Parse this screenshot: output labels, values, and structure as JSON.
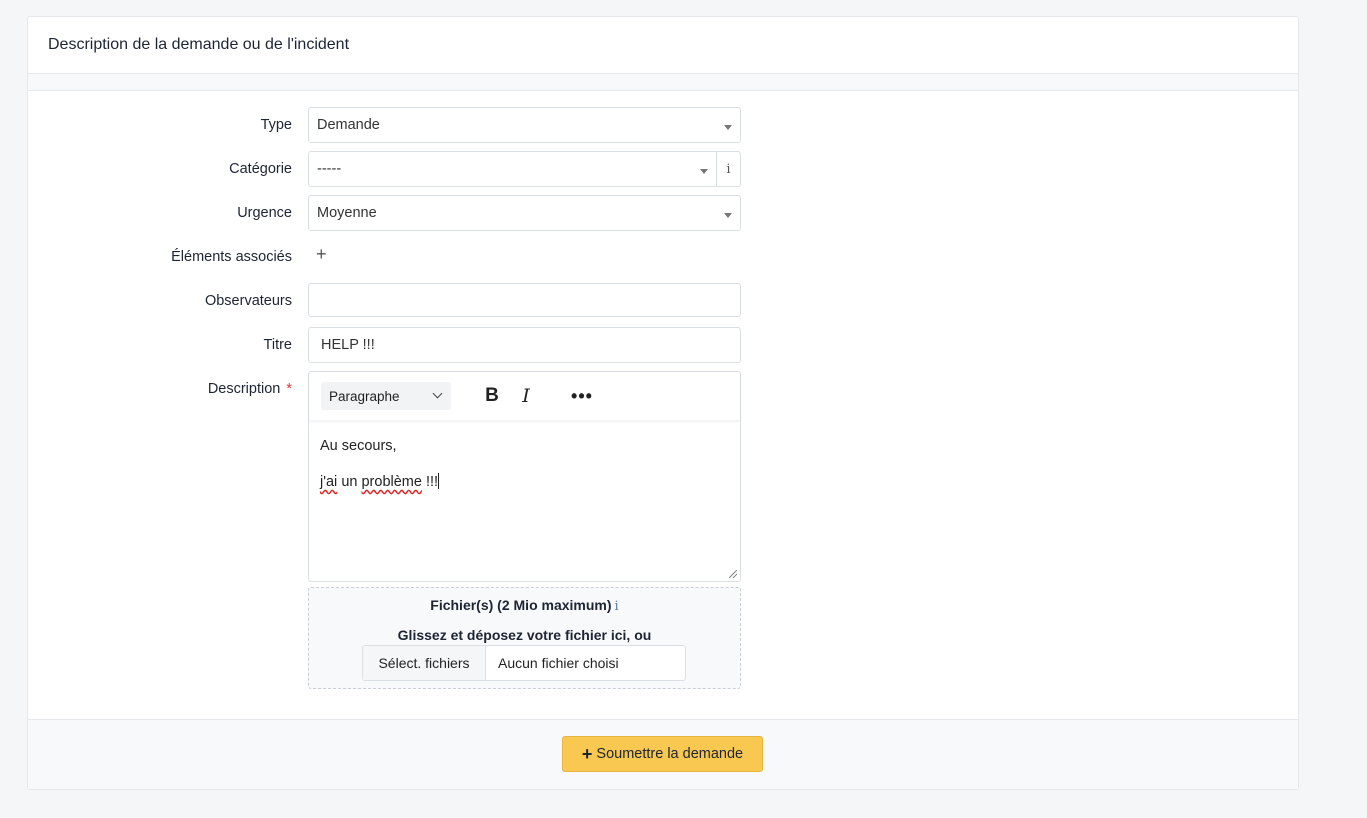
{
  "card": {
    "title": "Description de la demande ou de l'incident"
  },
  "form": {
    "type": {
      "label": "Type",
      "value": "Demande"
    },
    "category": {
      "label": "Catégorie",
      "value": "-----",
      "info_glyph": "i"
    },
    "urgency": {
      "label": "Urgence",
      "value": "Moyenne"
    },
    "linked_items": {
      "label": "Éléments associés",
      "add_glyph": "+"
    },
    "observers": {
      "label": "Observateurs",
      "value": ""
    },
    "title": {
      "label": "Titre",
      "value": "HELP !!!"
    },
    "description": {
      "label": "Description",
      "required_mark": "*",
      "toolbar": {
        "paragraph_format": "Paragraphe",
        "bold": "B",
        "italic": "I",
        "more": "•••"
      },
      "content_line1": "Au secours,",
      "content_line2_word1": "j'ai",
      "content_line2_word2": "un",
      "content_line2_word3": "problème",
      "content_line2_word4": "!!!"
    },
    "files": {
      "title": "Fichier(s) (2 Mio maximum)",
      "info_glyph": "i",
      "drop_text": "Glissez et déposez votre fichier ici, ou",
      "select_button": "Sélect. fichiers",
      "no_file_text": "Aucun fichier choisi"
    }
  },
  "footer": {
    "submit_icon": "+",
    "submit_label": "Soumettre la demande"
  }
}
